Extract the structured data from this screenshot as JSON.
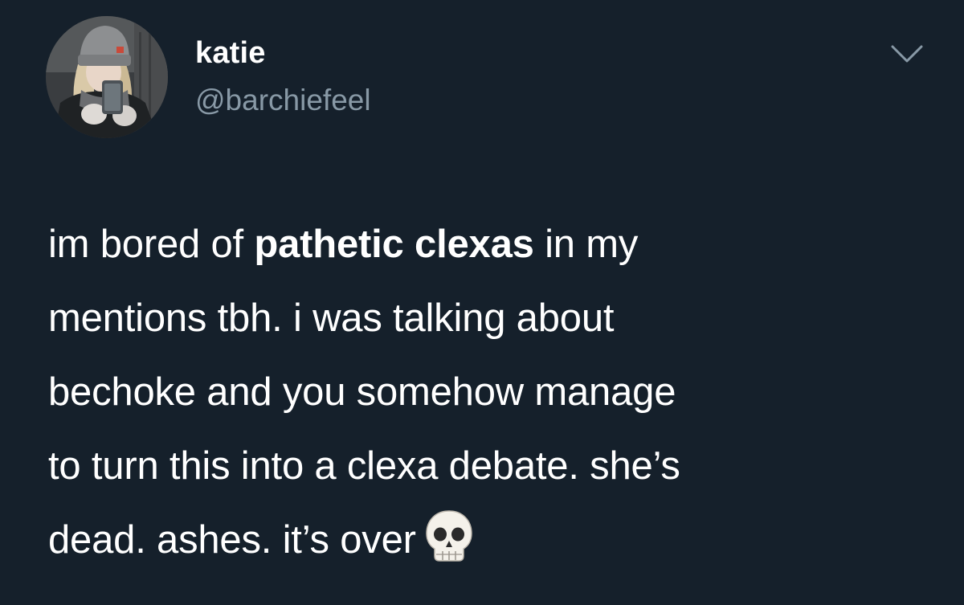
{
  "user": {
    "display_name": "katie",
    "handle": "@barchiefeel",
    "avatar_icon": "profile-photo"
  },
  "header": {
    "menu_icon": "chevron-down-icon"
  },
  "tweet": {
    "text_before_bold": "im bored of ",
    "bold_text": "pathetic clexas",
    "text_line1_rest": " in my",
    "line2": "mentions tbh. i was talking about",
    "line3": "bechoke and you somehow manage",
    "line4": "to turn this into a clexa debate. she’s",
    "line5": "dead. ashes. it’s over",
    "emoji": "skull-icon"
  },
  "colors": {
    "background": "#15202b",
    "primary_text": "#ffffff",
    "secondary_text": "#8899a6"
  }
}
